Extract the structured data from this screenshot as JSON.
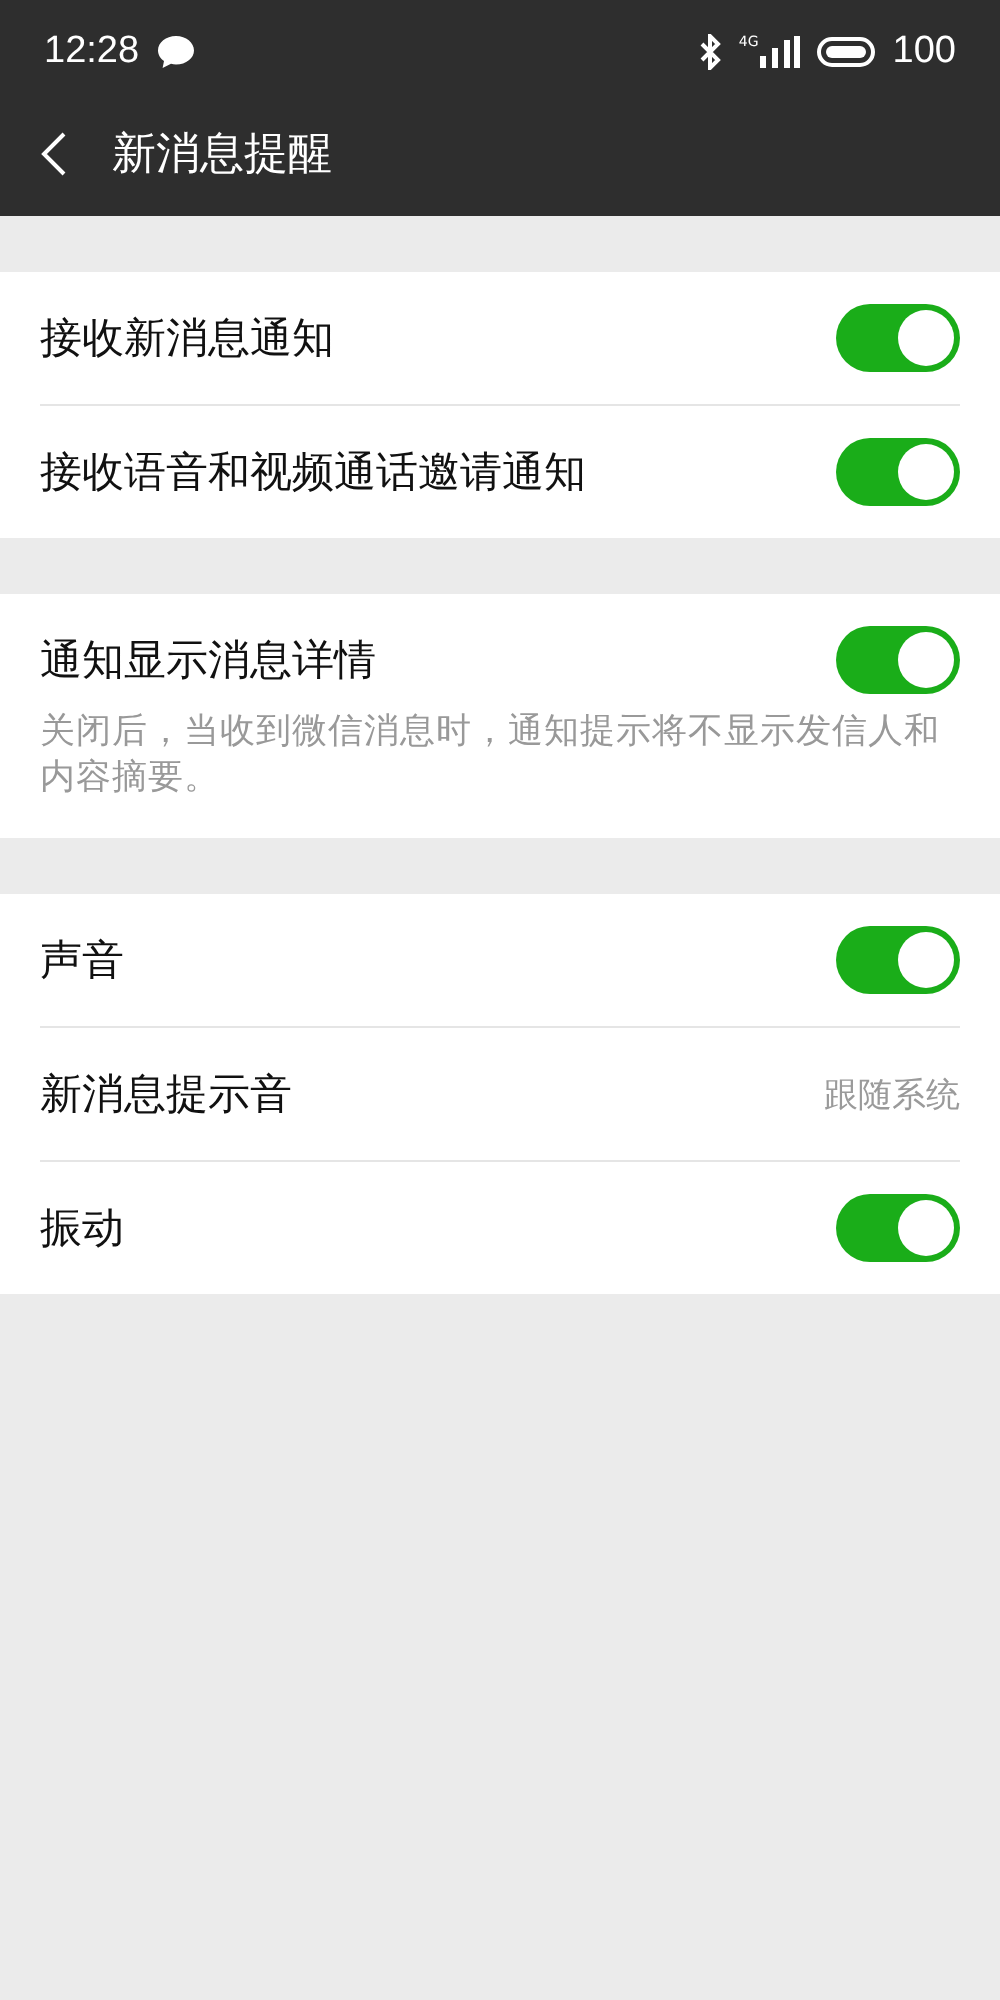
{
  "status_bar": {
    "time": "12:28",
    "network": "4G",
    "battery": "100"
  },
  "header": {
    "title": "新消息提醒"
  },
  "sections": [
    {
      "rows": [
        {
          "kind": "toggle",
          "label": "接收新消息通知",
          "on": true
        },
        {
          "kind": "toggle",
          "label": "接收语音和视频通话邀请通知",
          "on": true
        }
      ]
    },
    {
      "rows": [
        {
          "kind": "toggle",
          "label": "通知显示消息详情",
          "on": true
        }
      ],
      "note": "关闭后，当收到微信消息时，通知提示将不显示发信人和内容摘要。"
    },
    {
      "rows": [
        {
          "kind": "toggle",
          "label": "声音",
          "on": true
        },
        {
          "kind": "value",
          "label": "新消息提示音",
          "value": "跟随系统"
        },
        {
          "kind": "toggle",
          "label": "振动",
          "on": true
        }
      ]
    }
  ]
}
